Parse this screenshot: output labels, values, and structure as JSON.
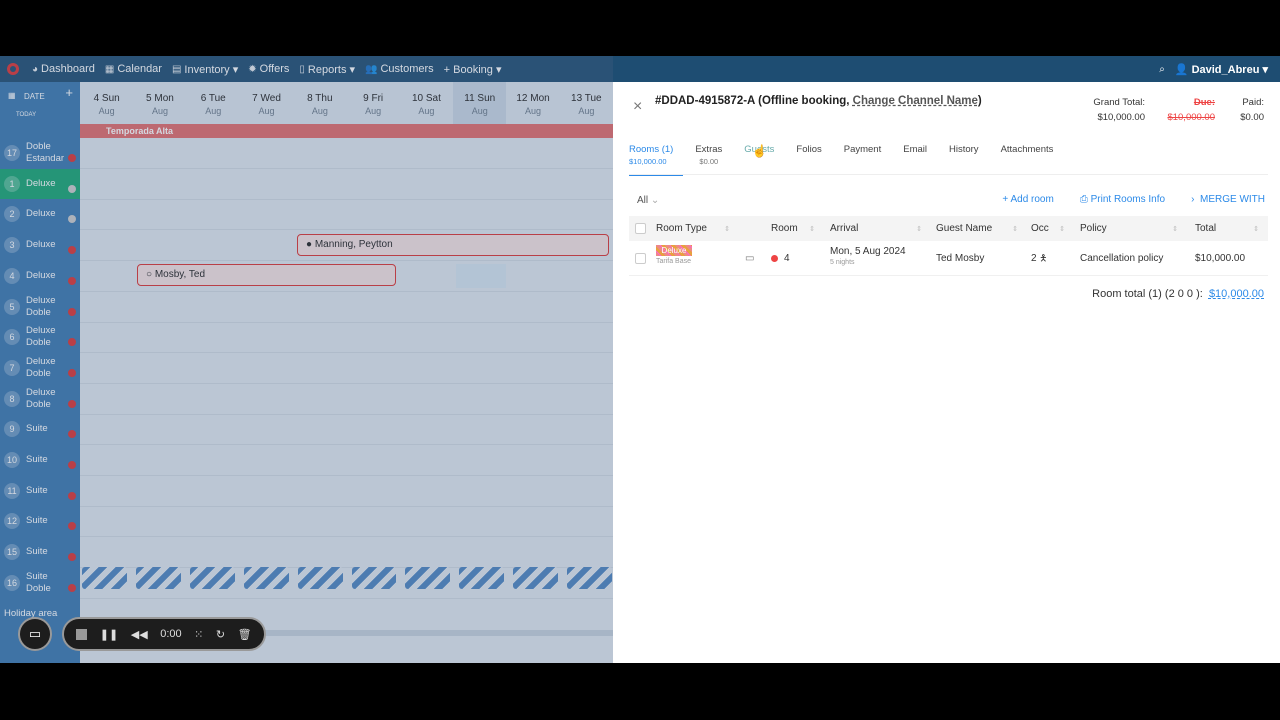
{
  "nav": {
    "items": [
      {
        "label": "Dashboard",
        "icon": "dashboard-icon"
      },
      {
        "label": "Calendar",
        "icon": "calendar-icon"
      },
      {
        "label": "Inventory ▾",
        "icon": "inventory-icon"
      },
      {
        "label": "Offers",
        "icon": "offers-icon"
      },
      {
        "label": "Reports ▾",
        "icon": "reports-icon"
      },
      {
        "label": "Customers",
        "icon": "customers-icon"
      },
      {
        "label": "+ Booking ▾",
        "icon": ""
      }
    ],
    "user": "David_Abreu ▾"
  },
  "calendar": {
    "corner_label": "DATE",
    "today_label": "TODAY",
    "days": [
      {
        "d": "4 Sun",
        "m": "Aug"
      },
      {
        "d": "5 Mon",
        "m": "Aug"
      },
      {
        "d": "6 Tue",
        "m": "Aug"
      },
      {
        "d": "7 Wed",
        "m": "Aug"
      },
      {
        "d": "8 Thu",
        "m": "Aug"
      },
      {
        "d": "9 Fri",
        "m": "Aug"
      },
      {
        "d": "10 Sat",
        "m": "Aug"
      },
      {
        "d": "11 Sun",
        "m": "Aug"
      },
      {
        "d": "12 Mon",
        "m": "Aug"
      },
      {
        "d": "13 Tue",
        "m": "Aug"
      }
    ],
    "season": "Temporada Alta",
    "rooms": [
      {
        "num": "17",
        "name": "Doble Estandar"
      },
      {
        "num": "1",
        "name": "Deluxe"
      },
      {
        "num": "2",
        "name": "Deluxe"
      },
      {
        "num": "3",
        "name": "Deluxe"
      },
      {
        "num": "4",
        "name": "Deluxe"
      },
      {
        "num": "5",
        "name": "Deluxe Doble"
      },
      {
        "num": "6",
        "name": "Deluxe Doble"
      },
      {
        "num": "7",
        "name": "Deluxe Doble"
      },
      {
        "num": "8",
        "name": "Deluxe Doble"
      },
      {
        "num": "9",
        "name": "Suite"
      },
      {
        "num": "10",
        "name": "Suite"
      },
      {
        "num": "11",
        "name": "Suite"
      },
      {
        "num": "12",
        "name": "Suite"
      },
      {
        "num": "15",
        "name": "Suite"
      },
      {
        "num": "16",
        "name": "Suite Doble"
      }
    ],
    "bookings": [
      {
        "label": "Manning, Peytton"
      },
      {
        "label": "Mosby, Ted"
      }
    ],
    "holiday_label": "Holiday area"
  },
  "video": {
    "time": "0:00"
  },
  "panel": {
    "booking_id": "#DDAD-4915872-A (Offline booking, ",
    "channel_link": "Change Channel Name",
    "title_tail": ")",
    "grand_total_label": "Grand Total:",
    "grand_total": "$10,000.00",
    "due_label": "Due:",
    "due": "$10,000.00",
    "paid_label": "Paid:",
    "paid": "$0.00",
    "tabs": [
      {
        "label": "Rooms (1)",
        "sub": "$10,000.00"
      },
      {
        "label": "Extras",
        "sub": "$0.00"
      },
      {
        "label": "Guests",
        "sub": ""
      },
      {
        "label": "Folios",
        "sub": ""
      },
      {
        "label": "Payment",
        "sub": ""
      },
      {
        "label": "Email",
        "sub": ""
      },
      {
        "label": "History",
        "sub": ""
      },
      {
        "label": "Attachments",
        "sub": ""
      }
    ],
    "filter": "All",
    "actions": {
      "add_room": "+ Add room",
      "print": "Print Rooms Info",
      "merge": "MERGE WITH"
    },
    "columns": [
      "Room Type",
      "Room",
      "Arrival",
      "Guest Name",
      "Occ",
      "Policy",
      "Total"
    ],
    "row": {
      "room_type_badge": "Deluxe",
      "rate": "Tarifa Base",
      "room": "4",
      "arrival": "Mon, 5 Aug 2024",
      "nights": "5 nights",
      "guest": "Ted Mosby",
      "occ": "2",
      "policy": "Cancellation policy",
      "total": "$10,000.00"
    },
    "room_total_label": "Room total (1)",
    "room_total_occ": "(2  0  0 ):",
    "room_total": "$10,000.00"
  }
}
